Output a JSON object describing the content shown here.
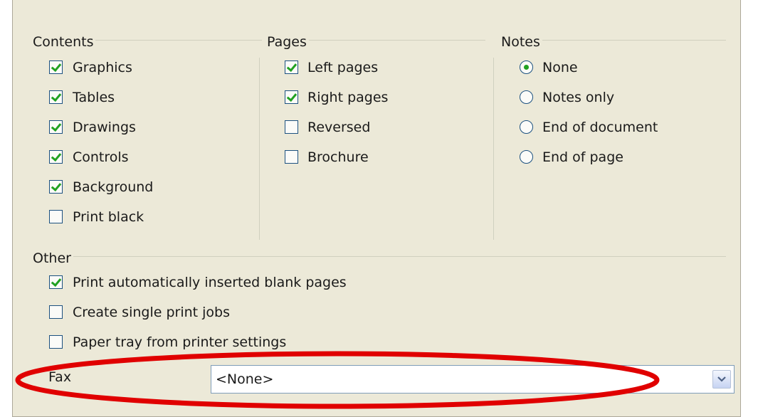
{
  "contents": {
    "title": "Contents",
    "items": [
      {
        "label": "Graphics",
        "checked": true
      },
      {
        "label": "Tables",
        "checked": true
      },
      {
        "label": "Drawings",
        "checked": true
      },
      {
        "label": "Controls",
        "checked": true
      },
      {
        "label": "Background",
        "checked": true
      },
      {
        "label": "Print black",
        "checked": false
      }
    ]
  },
  "pages": {
    "title": "Pages",
    "items": [
      {
        "label": "Left pages",
        "checked": true
      },
      {
        "label": "Right pages",
        "checked": true
      },
      {
        "label": "Reversed",
        "checked": false
      },
      {
        "label": "Brochure",
        "checked": false
      }
    ]
  },
  "notes": {
    "title": "Notes",
    "options": [
      {
        "label": "None",
        "selected": true
      },
      {
        "label": "Notes only",
        "selected": false
      },
      {
        "label": "End of document",
        "selected": false
      },
      {
        "label": "End of page",
        "selected": false
      }
    ]
  },
  "other": {
    "title": "Other",
    "items": [
      {
        "label": "Print automatically inserted blank pages",
        "checked": true
      },
      {
        "label": "Create single print jobs",
        "checked": false
      },
      {
        "label": "Paper tray from printer settings",
        "checked": false
      }
    ]
  },
  "fax": {
    "label": "Fax",
    "value": "<None>"
  },
  "icons": {
    "dropdown": "chevron-down-icon"
  },
  "colors": {
    "panel_bg": "#ece9d8",
    "check_green": "#21a121",
    "highlight_ellipse": "#e00000"
  }
}
